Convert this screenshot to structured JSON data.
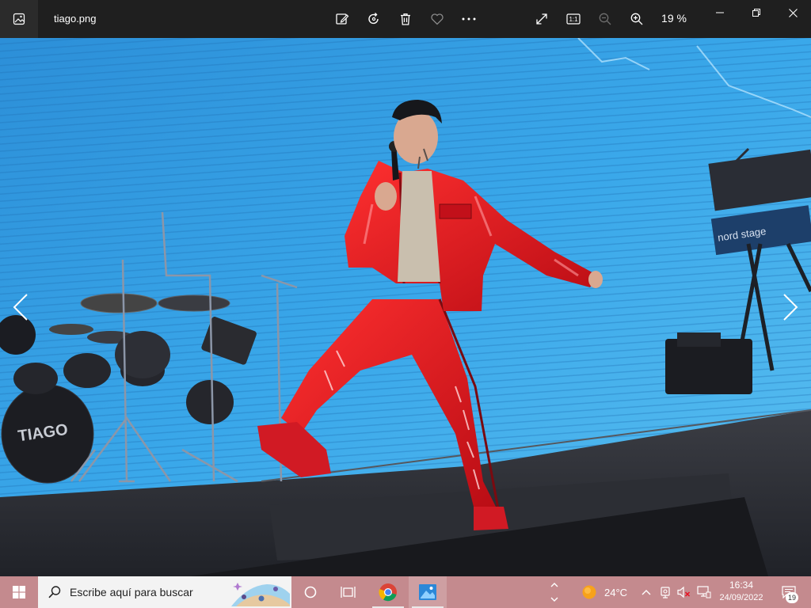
{
  "window": {
    "title": "tiago.png",
    "zoom_level": "19 %",
    "actual_size_label": "1:1"
  },
  "toolbar": {
    "icons": [
      "edit-image-icon",
      "rotate-icon",
      "delete-icon",
      "favorite-icon",
      "more-icon",
      "fullscreen-icon",
      "actual-size-icon",
      "zoom-out-icon",
      "zoom-in-icon"
    ]
  },
  "photo": {
    "drum_logo_text": "TIAGO",
    "keyboard_brand_text": "nord stage"
  },
  "taskbar": {
    "search_placeholder": "Escribe aquí para buscar",
    "weather_temp": "24°C",
    "clock_time": "16:34",
    "clock_date": "24/09/2022",
    "notification_count": "19"
  },
  "colors": {
    "titlebar_bg": "#1f1f1f",
    "taskbar_bg": "#c48a8e",
    "screen_blue": "#2aa0e4",
    "jacket_red": "#e0141e"
  }
}
